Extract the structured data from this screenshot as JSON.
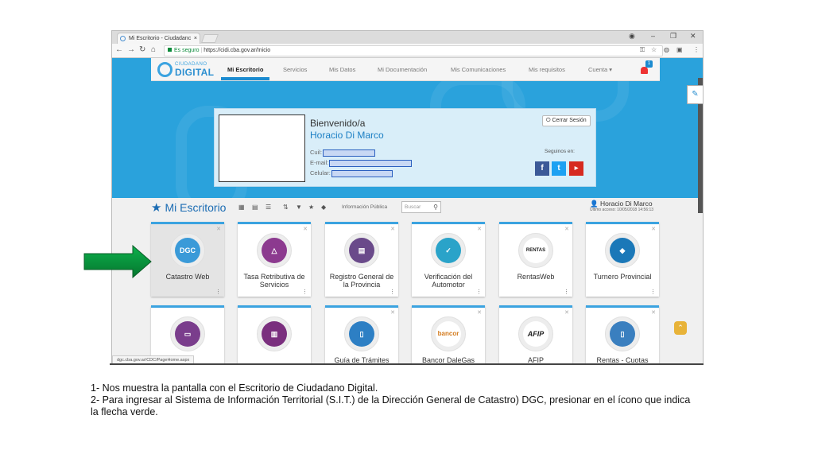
{
  "browser": {
    "tab_title": "Mi Escritorio - Ciudadanc",
    "tab_close": "×",
    "secure_label": "Es seguro",
    "url": "https://cidi.cba.gov.ar/Inicio",
    "status_url": "dgc.cba.gov.ar/CDC/PageHome.aspx"
  },
  "logo": {
    "line1": "CIUDADANO",
    "line2": "DIGITAL"
  },
  "nav": {
    "items": [
      "Mi Escritorio",
      "Servicios",
      "Mis Datos",
      "Mi Documentación",
      "Mis Comunicaciones",
      "Mis requisitos",
      "Cuenta ▾"
    ],
    "notification_count": "1"
  },
  "profile": {
    "welcome": "Bienvenido/a",
    "name": "Horacio Di Marco",
    "cuil_label": "Cuil:",
    "email_label": "E-mail:",
    "celular_label": "Celular:",
    "logout_label": "⏻ Cerrar Sesión",
    "follow_label": "Seguinos en:"
  },
  "desk": {
    "title": "Mi Escritorio",
    "info_publica": "Información Pública",
    "search_placeholder": "Buscar",
    "user_name": "Horacio Di Marco",
    "last_access": "Último acceso: 10/05/2018 14:56:13"
  },
  "tiles_row1": [
    {
      "label": "Catastro Web",
      "icon_text": "DGC"
    },
    {
      "label": "Tasa Retributiva de Servicios",
      "icon_text": ""
    },
    {
      "label": "Registro General de la Provincia",
      "icon_text": ""
    },
    {
      "label": "Verificación del Automotor",
      "icon_text": ""
    },
    {
      "label": "RentasWeb",
      "icon_text": "RENTAS"
    },
    {
      "label": "Turnero Provincial",
      "icon_text": ""
    }
  ],
  "tiles_row2": [
    {
      "label": "",
      "icon_text": ""
    },
    {
      "label": "",
      "icon_text": ""
    },
    {
      "label": "Guía de Trámites",
      "icon_text": ""
    },
    {
      "label": "Bancor DaleGas",
      "icon_text": "bancor"
    },
    {
      "label": "AFIP",
      "icon_text": "AFIP"
    },
    {
      "label": "Rentas - Cuotas",
      "icon_text": ""
    }
  ],
  "notes": {
    "line1": "1- Nos muestra la pantalla con el Escritorio de Ciudadano Digital.",
    "line2": "2- Para ingresar al Sistema de Información Territorial (S.I.T.) de la Dirección General de Catastro) DGC, presionar en el ícono que indica la flecha verde."
  },
  "colors": {
    "hero": "#2aa2dc",
    "accent": "#1b8bd0",
    "arrow": "#0a9a3c"
  }
}
